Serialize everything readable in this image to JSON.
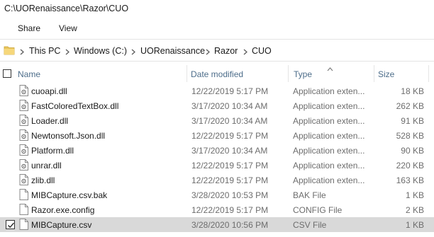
{
  "window": {
    "title": "C:\\UORenaissance\\Razor\\CUO"
  },
  "ribbon": {
    "tabs": [
      "Share",
      "View"
    ]
  },
  "address": {
    "folder_icon": "folder-icon",
    "breadcrumb": [
      "This PC",
      "Windows (C:)",
      "UORenaissance",
      "Razor",
      "CUO"
    ]
  },
  "columns": {
    "name": "Name",
    "date": "Date modified",
    "type": "Type",
    "size": "Size",
    "sort": "ascending"
  },
  "files": [
    {
      "name": "cuoapi.dll",
      "date": "12/22/2019 5:17 PM",
      "type": "Application exten...",
      "size": "18 KB",
      "icon": "dll-icon",
      "selected": false
    },
    {
      "name": "FastColoredTextBox.dll",
      "date": "3/17/2020 10:34 AM",
      "type": "Application exten...",
      "size": "262 KB",
      "icon": "dll-icon",
      "selected": false
    },
    {
      "name": "Loader.dll",
      "date": "3/17/2020 10:34 AM",
      "type": "Application exten...",
      "size": "91 KB",
      "icon": "dll-icon",
      "selected": false
    },
    {
      "name": "Newtonsoft.Json.dll",
      "date": "12/22/2019 5:17 PM",
      "type": "Application exten...",
      "size": "528 KB",
      "icon": "dll-icon",
      "selected": false
    },
    {
      "name": "Platform.dll",
      "date": "3/17/2020 10:34 AM",
      "type": "Application exten...",
      "size": "90 KB",
      "icon": "dll-icon",
      "selected": false
    },
    {
      "name": "unrar.dll",
      "date": "12/22/2019 5:17 PM",
      "type": "Application exten...",
      "size": "220 KB",
      "icon": "dll-icon",
      "selected": false
    },
    {
      "name": "zlib.dll",
      "date": "12/22/2019 5:17 PM",
      "type": "Application exten...",
      "size": "163 KB",
      "icon": "dll-icon",
      "selected": false
    },
    {
      "name": "MIBCapture.csv.bak",
      "date": "3/28/2020 10:53 PM",
      "type": "BAK File",
      "size": "1 KB",
      "icon": "file-icon",
      "selected": false
    },
    {
      "name": "Razor.exe.config",
      "date": "12/22/2019 5:17 PM",
      "type": "CONFIG File",
      "size": "2 KB",
      "icon": "file-icon",
      "selected": false
    },
    {
      "name": "MIBCapture.csv",
      "date": "3/28/2020 10:56 PM",
      "type": "CSV File",
      "size": "1 KB",
      "icon": "file-icon",
      "selected": true
    }
  ]
}
